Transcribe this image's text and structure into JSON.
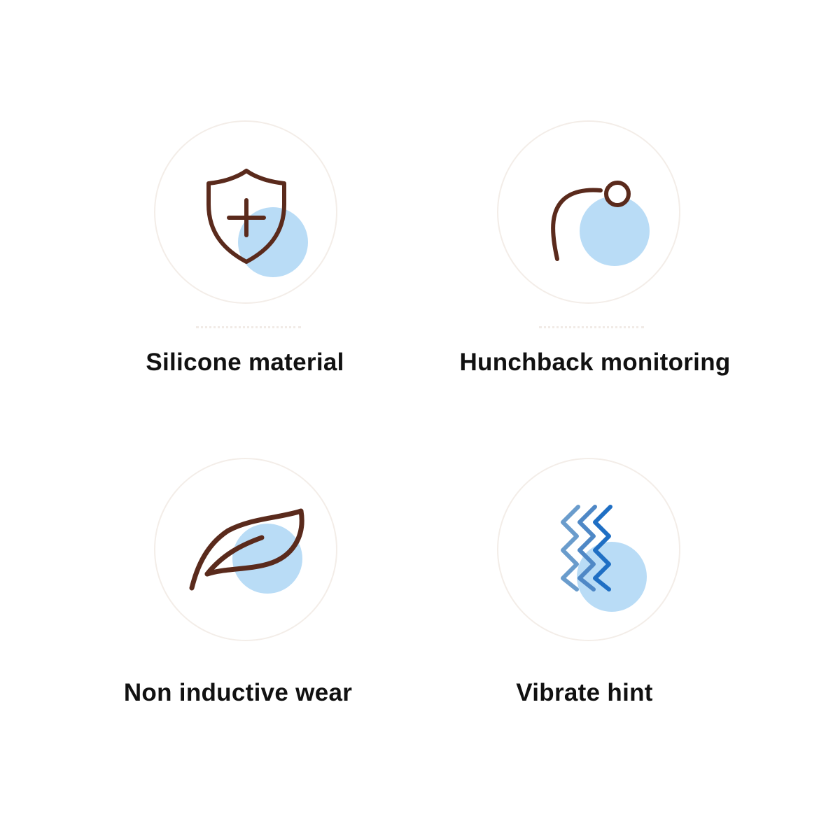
{
  "colors": {
    "background": "#ffffff",
    "circle_border": "#f3ede8",
    "icon_stroke": "#5a2a1c",
    "accent_blob": "#b9dcf6",
    "wave_dark": "#1f6fc4",
    "wave_light": "#6a9ccc",
    "text": "#111111"
  },
  "features": [
    {
      "label": "Silicone material",
      "icon": "shield-plus-icon"
    },
    {
      "label": "Hunchback monitoring",
      "icon": "posture-curve-icon"
    },
    {
      "label": "Non inductive wear",
      "icon": "leaf-icon"
    },
    {
      "label": "Vibrate hint",
      "icon": "vibration-waves-icon"
    }
  ]
}
